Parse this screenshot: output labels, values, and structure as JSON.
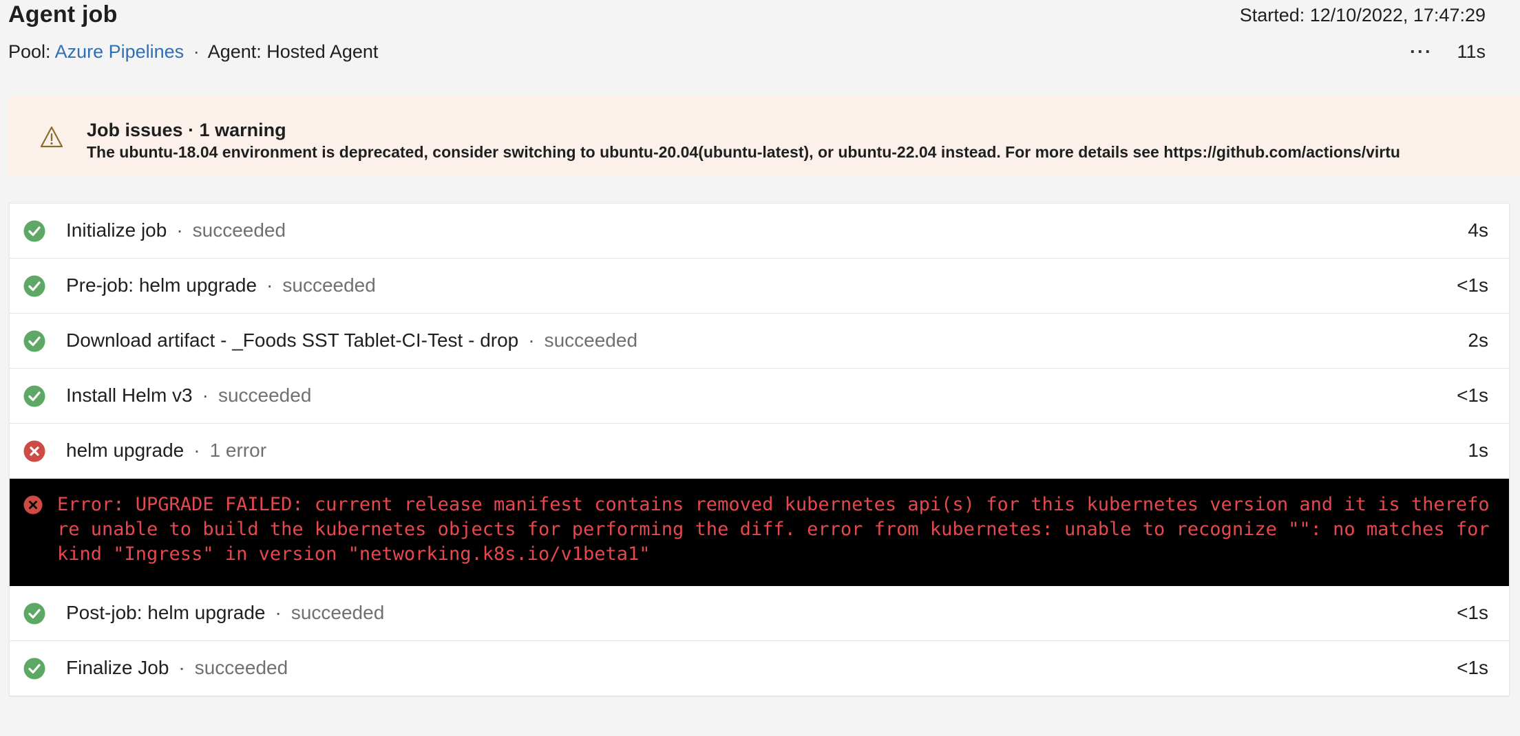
{
  "header": {
    "title": "Agent job",
    "started": "Started: 12/10/2022, 17:47:29",
    "pool_label": "Pool:",
    "pool_link": "Azure Pipelines",
    "separator": "·",
    "agent": "Agent: Hosted Agent",
    "more_label": "···",
    "duration": "11s"
  },
  "issues": {
    "title": "Job issues · 1 warning",
    "message": "The ubuntu-18.04 environment is deprecated, consider switching to ubuntu-20.04(ubuntu-latest), or ubuntu-22.04 instead. For more details see https://github.com/actions/virtu",
    "icon": "warning-icon",
    "color": "#8a6d2b"
  },
  "steps": [
    {
      "name": "Initialize job",
      "sep": "·",
      "status": "succeeded",
      "duration": "4s",
      "icon": "success-check-icon"
    },
    {
      "name": "Pre-job: helm upgrade",
      "sep": "·",
      "status": "succeeded",
      "duration": "<1s",
      "icon": "success-check-icon"
    },
    {
      "name": "Download artifact - _Foods SST Tablet-CI-Test - drop",
      "sep": "·",
      "status": "succeeded",
      "duration": "2s",
      "icon": "success-check-icon"
    },
    {
      "name": "Install Helm v3",
      "sep": "·",
      "status": "succeeded",
      "duration": "<1s",
      "icon": "success-check-icon"
    },
    {
      "name": "helm upgrade",
      "sep": "·",
      "status": "1 error",
      "duration": "1s",
      "icon": "error-x-icon"
    },
    {
      "name": "Post-job: helm upgrade",
      "sep": "·",
      "status": "succeeded",
      "duration": "<1s",
      "icon": "success-check-icon"
    },
    {
      "name": "Finalize Job",
      "sep": "·",
      "status": "succeeded",
      "duration": "<1s",
      "icon": "success-check-icon"
    }
  ],
  "error": {
    "text": "Error: UPGRADE FAILED: current release manifest contains removed kubernetes api(s) for this kubernetes version and it is therefore unable to build the kubernetes objects for performing the diff. error from kubernetes: unable to recognize \"\": no matches for kind \"Ingress\" in version \"networking.k8s.io/v1beta1\"",
    "color": "#e5484d"
  },
  "colors": {
    "success": "#5ea866",
    "error": "#cd4a45",
    "link": "#2f6fb5",
    "banner": "#fbf1ea"
  }
}
